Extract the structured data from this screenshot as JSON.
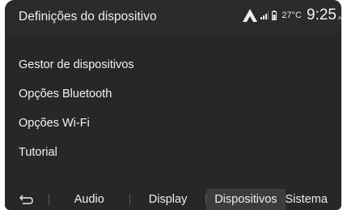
{
  "header": {
    "title": "Definições do dispositivo"
  },
  "status_bar": {
    "icons": [
      "android-auto-icon",
      "signal-icon",
      "battery-icon"
    ],
    "temperature": "27°C",
    "time": "9:25",
    "ampm": "A"
  },
  "menu": {
    "items": [
      {
        "label": "Gestor de dispositivos"
      },
      {
        "label": "Opções Bluetooth"
      },
      {
        "label": "Opções Wi-Fi"
      },
      {
        "label": "Tutorial"
      }
    ]
  },
  "tabs": {
    "back_icon": "back-arrow-icon",
    "items": [
      {
        "label": "Audio",
        "selected": false
      },
      {
        "label": "Display",
        "selected": false
      },
      {
        "label": "Dispositivos",
        "selected": true
      },
      {
        "label": "Sistema",
        "selected": false
      }
    ]
  },
  "colors": {
    "background": "#272727",
    "selected_tab": "#3c3c3c",
    "text": "#f2f2f2"
  }
}
